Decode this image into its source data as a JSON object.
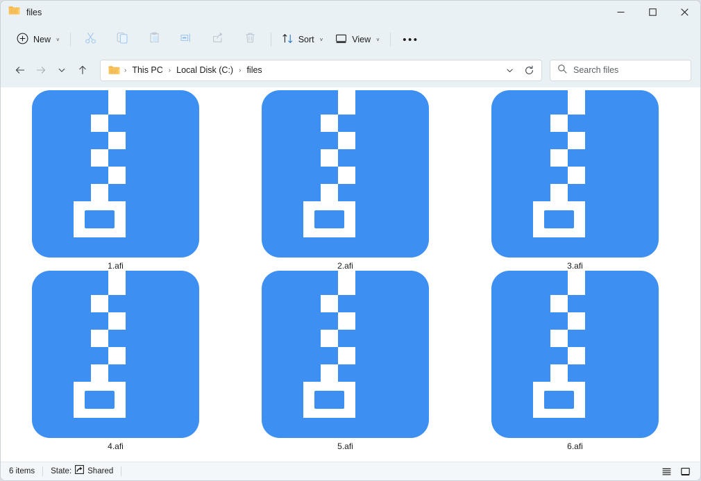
{
  "window": {
    "title": "files",
    "title_icon": "folder-icon",
    "controls": {
      "minimize": "—",
      "maximize": "☐",
      "close": "✕"
    }
  },
  "toolbar": {
    "new_label": "New",
    "new_icon": "plus-circle-icon",
    "cut_icon": "scissors-icon",
    "copy_icon": "copy-icon",
    "paste_icon": "paste-icon",
    "rename_icon": "rename-icon",
    "share_icon": "share-icon",
    "delete_icon": "trash-icon",
    "sort_label": "Sort",
    "sort_icon": "sort-arrows-icon",
    "view_label": "View",
    "view_icon": "monitor-icon",
    "overflow_label": "•••",
    "chevron": "˅"
  },
  "address": {
    "back_icon": "arrow-left-icon",
    "forward_icon": "arrow-right-icon",
    "recent_icon": "chevron-down-icon",
    "up_icon": "arrow-up-icon",
    "folder_icon": "folder-icon",
    "crumbs": [
      "This PC",
      "Local Disk (C:)",
      "files"
    ],
    "separator": "›",
    "dropdown_icon": "chevron-down-icon",
    "refresh_icon": "refresh-icon"
  },
  "search": {
    "placeholder": "Search files",
    "value": "",
    "icon": "search-icon"
  },
  "files": [
    {
      "name": "1.afi",
      "icon": "zip-file-icon"
    },
    {
      "name": "2.afi",
      "icon": "zip-file-icon"
    },
    {
      "name": "3.afi",
      "icon": "zip-file-icon"
    },
    {
      "name": "4.afi",
      "icon": "zip-file-icon"
    },
    {
      "name": "5.afi",
      "icon": "zip-file-icon"
    },
    {
      "name": "6.afi",
      "icon": "zip-file-icon"
    }
  ],
  "status": {
    "item_count": "6 items",
    "state_label": "State:",
    "state_value": "Shared",
    "state_icon": "share-icon",
    "details_view_icon": "details-view-icon",
    "large_icons_view_icon": "large-icons-view-icon"
  },
  "colors": {
    "icon_blue": "#3d90f2",
    "chrome": "#eaf1f4",
    "accent": "#0078d4",
    "folder_yellow": "#f7b84b"
  }
}
